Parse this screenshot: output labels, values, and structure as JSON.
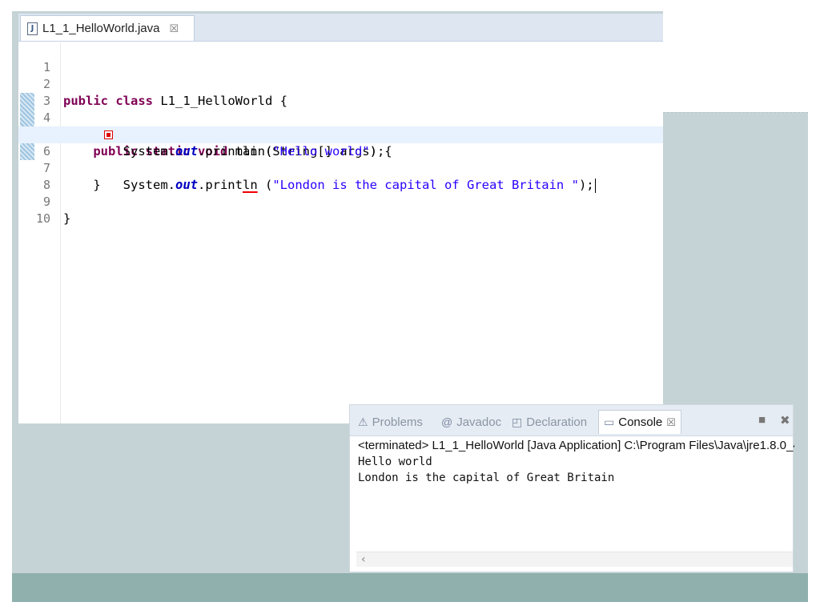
{
  "editor": {
    "tab_title": "L1_1_HelloWorld.java",
    "tab_close": "☒",
    "line_numbers": [
      "1",
      "2",
      "3",
      "4",
      "5",
      "6",
      "7",
      "8",
      "9",
      "10"
    ],
    "fold_marker": "⊖",
    "code": {
      "l2_kw": "public class ",
      "l2_rest": "L1_1_HelloWorld {",
      "l4_indent": "    ",
      "l4_kw": "public static void ",
      "l4_rest": "main(String[] args) {",
      "l5_pre": "        System.",
      "l5_field": "out",
      "l5_mid": ".println (",
      "l5_str": "\"Hello world\"",
      "l5_end": ");",
      "l6_pre": "        System.",
      "l6_field": "out",
      "l6_mid1": ".print",
      "l6_err": "ln",
      "l6_mid2": " (",
      "l6_str": "\"London is the capital of Great Britain \"",
      "l6_end": ");",
      "l7": "    }",
      "l9": "}"
    }
  },
  "console": {
    "tabs": [
      {
        "label": "Problems",
        "icon": "problems-icon",
        "glyph": "⚠"
      },
      {
        "label": "Javadoc",
        "icon": "javadoc-icon",
        "glyph": "@"
      },
      {
        "label": "Declaration",
        "icon": "declaration-icon",
        "glyph": "◰"
      },
      {
        "label": "Console",
        "icon": "console-icon",
        "glyph": "▭"
      }
    ],
    "console_close": "☒",
    "stop_glyph": "■",
    "remove_glyph": "✖",
    "status": "<terminated> L1_1_HelloWorld [Java Application] C:\\Program Files\\Java\\jre1.8.0_4",
    "output": [
      "Hello world",
      "London is the capital of Great Britain"
    ],
    "scroll_left": "‹"
  }
}
